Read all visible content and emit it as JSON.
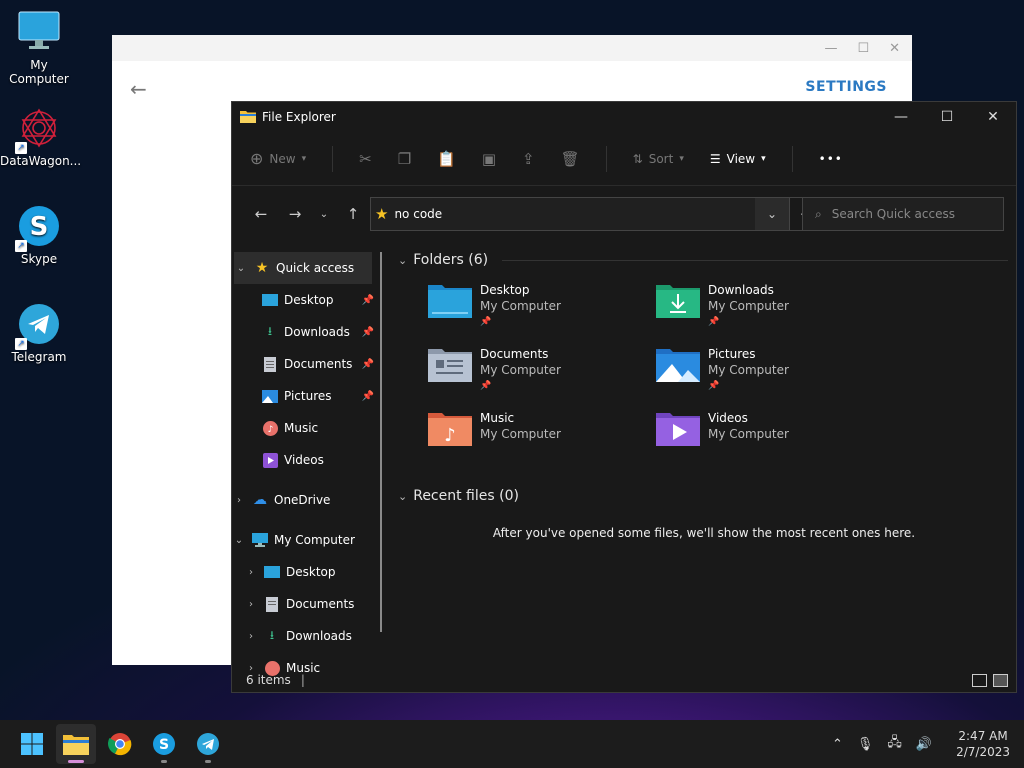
{
  "desktop": {
    "icons": [
      {
        "label": "My Computer"
      },
      {
        "label": "DataWagon..."
      },
      {
        "label": "Skype"
      },
      {
        "label": "Telegram"
      }
    ]
  },
  "settings_window": {
    "header_label": "SETTINGS"
  },
  "explorer": {
    "title": "File Explorer",
    "toolbar": {
      "new_label": "New",
      "sort_label": "Sort",
      "view_label": "View",
      "more_label": "•••"
    },
    "address": {
      "path": "no code",
      "search_placeholder": "Search Quick access"
    },
    "sidebar": {
      "quick_access": "Quick access",
      "quick_items": [
        {
          "label": "Desktop"
        },
        {
          "label": "Downloads"
        },
        {
          "label": "Documents"
        },
        {
          "label": "Pictures"
        },
        {
          "label": "Music"
        },
        {
          "label": "Videos"
        }
      ],
      "onedrive": "OneDrive",
      "my_computer": "My Computer",
      "pc_items": [
        {
          "label": "Desktop"
        },
        {
          "label": "Documents"
        },
        {
          "label": "Downloads"
        },
        {
          "label": "Music"
        }
      ]
    },
    "folders_header": "Folders (6)",
    "folders": [
      {
        "name": "Desktop",
        "location": "My Computer",
        "pinned": "📌"
      },
      {
        "name": "Downloads",
        "location": "My Computer",
        "pinned": "📌"
      },
      {
        "name": "Documents",
        "location": "My Computer",
        "pinned": "📌"
      },
      {
        "name": "Pictures",
        "location": "My Computer",
        "pinned": "📌"
      },
      {
        "name": "Music",
        "location": "My Computer",
        "pinned": ""
      },
      {
        "name": "Videos",
        "location": "My Computer",
        "pinned": ""
      }
    ],
    "recent_header": "Recent files (0)",
    "recent_message": "After you've opened some files, we'll show the most recent ones here.",
    "status": "6 items"
  },
  "taskbar": {
    "time": "2:47 AM",
    "date": "2/7/2023"
  }
}
